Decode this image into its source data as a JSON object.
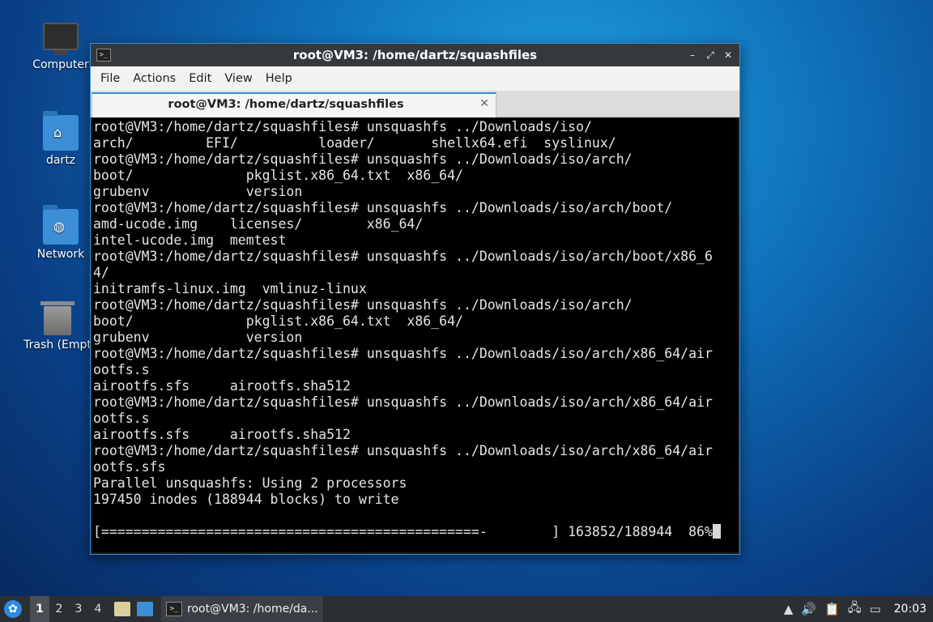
{
  "desktop": {
    "icons": [
      {
        "label": "Computer"
      },
      {
        "label": "dartz"
      },
      {
        "label": "Network"
      },
      {
        "label": "Trash (Empt"
      }
    ]
  },
  "window": {
    "title": "root@VM3: /home/dartz/squashfiles",
    "controls": {
      "minimize": "–",
      "maximize": "⤢",
      "close": "✕"
    },
    "menu": [
      "File",
      "Actions",
      "Edit",
      "View",
      "Help"
    ],
    "tab": {
      "label": "root@VM3: /home/dartz/squashfiles",
      "close": "✕"
    }
  },
  "terminal": {
    "lines": [
      "root@VM3:/home/dartz/squashfiles# unsquashfs ../Downloads/iso/",
      "arch/         EFI/          loader/       shellx64.efi  syslinux/",
      "root@VM3:/home/dartz/squashfiles# unsquashfs ../Downloads/iso/arch/",
      "boot/              pkglist.x86_64.txt  x86_64/",
      "grubenv            version",
      "root@VM3:/home/dartz/squashfiles# unsquashfs ../Downloads/iso/arch/boot/",
      "amd-ucode.img    licenses/        x86_64/",
      "intel-ucode.img  memtest",
      "root@VM3:/home/dartz/squashfiles# unsquashfs ../Downloads/iso/arch/boot/x86_6",
      "4/",
      "initramfs-linux.img  vmlinuz-linux",
      "root@VM3:/home/dartz/squashfiles# unsquashfs ../Downloads/iso/arch/",
      "boot/              pkglist.x86_64.txt  x86_64/",
      "grubenv            version",
      "root@VM3:/home/dartz/squashfiles# unsquashfs ../Downloads/iso/arch/x86_64/air",
      "ootfs.s",
      "airootfs.sfs     airootfs.sha512",
      "root@VM3:/home/dartz/squashfiles# unsquashfs ../Downloads/iso/arch/x86_64/air",
      "ootfs.s",
      "airootfs.sfs     airootfs.sha512",
      "root@VM3:/home/dartz/squashfiles# unsquashfs ../Downloads/iso/arch/x86_64/air",
      "ootfs.sfs",
      "Parallel unsquashfs: Using 2 processors",
      "197450 inodes (188944 blocks) to write",
      "",
      "[===============================================-        ] 163852/188944  86%"
    ]
  },
  "taskbar": {
    "workspaces": [
      "1",
      "2",
      "3",
      "4"
    ],
    "active_workspace": "1",
    "task_label": "root@VM3: /home/da...",
    "clock": "20:03"
  }
}
